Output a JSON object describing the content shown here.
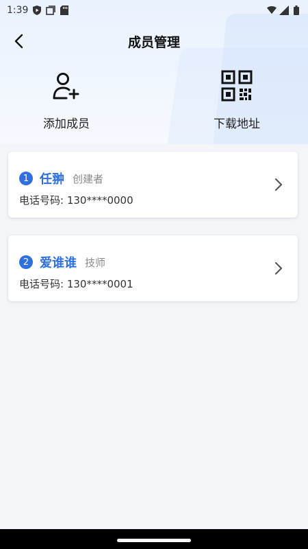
{
  "status_bar": {
    "time": "1:39"
  },
  "nav": {
    "title": "成员管理"
  },
  "actions": [
    {
      "label": "添加成员",
      "icon": "add-user-icon"
    },
    {
      "label": "下载地址",
      "icon": "qr-code-icon"
    }
  ],
  "members": [
    {
      "index": "1",
      "name": "任翀",
      "role": "创建者",
      "phone_label": "电话号码:",
      "phone": "130****0000"
    },
    {
      "index": "2",
      "name": "爱谁谁",
      "role": "技师",
      "phone_label": "电话号码:",
      "phone": "130****0001"
    }
  ],
  "colors": {
    "accent": "#2f6fe0",
    "background": "#f3f5f8"
  }
}
